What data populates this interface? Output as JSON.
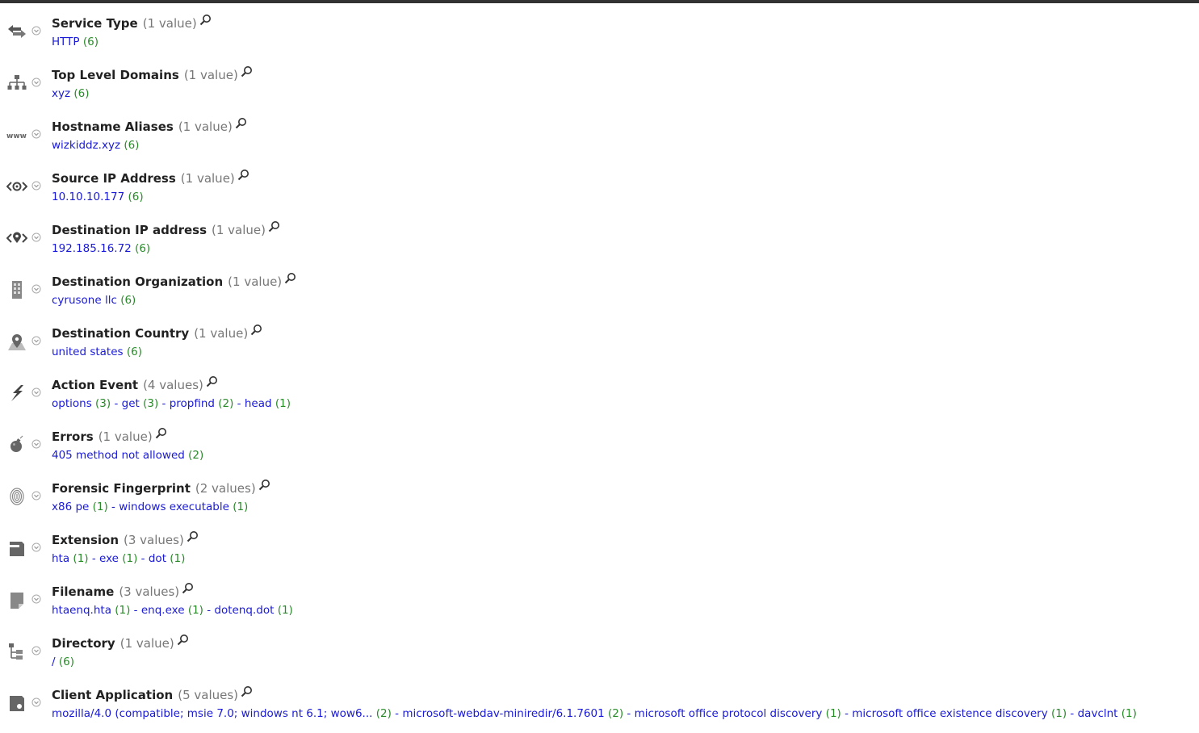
{
  "colors": {
    "value_link": "#1a1ad6",
    "value_count": "#2a8a2a",
    "title": "#222222",
    "count_text": "#777777",
    "icon_gray": "#666666"
  },
  "separator": " - ",
  "meta": [
    {
      "title": "Service Type",
      "count": "(1 value)",
      "icon": "arrows-exchange-icon",
      "values": [
        {
          "label": "HTTP",
          "count": "(6)"
        }
      ]
    },
    {
      "title": "Top Level Domains",
      "count": "(1 value)",
      "icon": "network-tree-icon",
      "values": [
        {
          "label": "xyz",
          "count": "(6)"
        }
      ]
    },
    {
      "title": "Hostname Aliases",
      "count": "(1 value)",
      "icon": "www-icon",
      "values": [
        {
          "label": "wizkiddz.xyz",
          "count": "(6)"
        }
      ]
    },
    {
      "title": "Source IP Address",
      "count": "(1 value)",
      "icon": "source-ip-icon",
      "values": [
        {
          "label": "10.10.10.177",
          "count": "(6)"
        }
      ]
    },
    {
      "title": "Destination IP address",
      "count": "(1 value)",
      "icon": "destination-ip-icon",
      "values": [
        {
          "label": "192.185.16.72",
          "count": "(6)"
        }
      ]
    },
    {
      "title": "Destination Organization",
      "count": "(1 value)",
      "icon": "building-icon",
      "values": [
        {
          "label": "cyrusone llc",
          "count": "(6)"
        }
      ]
    },
    {
      "title": "Destination Country",
      "count": "(1 value)",
      "icon": "map-pin-icon",
      "values": [
        {
          "label": "united states",
          "count": "(6)"
        }
      ]
    },
    {
      "title": "Action Event",
      "count": "(4 values)",
      "icon": "lightning-icon",
      "values": [
        {
          "label": "options",
          "count": "(3)"
        },
        {
          "label": "get",
          "count": "(3)"
        },
        {
          "label": "propfind",
          "count": "(2)"
        },
        {
          "label": "head",
          "count": "(1)"
        }
      ]
    },
    {
      "title": "Errors",
      "count": "(1 value)",
      "icon": "bomb-icon",
      "values": [
        {
          "label": "405 method not allowed",
          "count": "(2)"
        }
      ]
    },
    {
      "title": "Forensic Fingerprint",
      "count": "(2 values)",
      "icon": "fingerprint-icon",
      "values": [
        {
          "label": "x86 pe",
          "count": "(1)"
        },
        {
          "label": "windows executable",
          "count": "(1)"
        }
      ]
    },
    {
      "title": "Extension",
      "count": "(3 values)",
      "icon": "file-extension-icon",
      "values": [
        {
          "label": "hta",
          "count": "(1)"
        },
        {
          "label": "exe",
          "count": "(1)"
        },
        {
          "label": "dot",
          "count": "(1)"
        }
      ]
    },
    {
      "title": "Filename",
      "count": "(3 values)",
      "icon": "file-icon",
      "values": [
        {
          "label": "htaenq.hta",
          "count": "(1)"
        },
        {
          "label": "enq.exe",
          "count": "(1)"
        },
        {
          "label": "dotenq.dot",
          "count": "(1)"
        }
      ]
    },
    {
      "title": "Directory",
      "count": "(1 value)",
      "icon": "directory-tree-icon",
      "values": [
        {
          "label": "/",
          "count": "(6)"
        }
      ]
    },
    {
      "title": "Client Application",
      "count": "(5 values)",
      "icon": "client-application-icon",
      "values": [
        {
          "label": "mozilla/4.0 (compatible; msie 7.0; windows nt 6.1; wow6...",
          "count": "(2)"
        },
        {
          "label": "microsoft-webdav-miniredir/6.1.7601",
          "count": "(2)"
        },
        {
          "label": "microsoft office protocol discovery",
          "count": "(1)"
        },
        {
          "label": "microsoft office existence discovery",
          "count": "(1)"
        },
        {
          "label": "davclnt",
          "count": "(1)"
        }
      ]
    }
  ]
}
